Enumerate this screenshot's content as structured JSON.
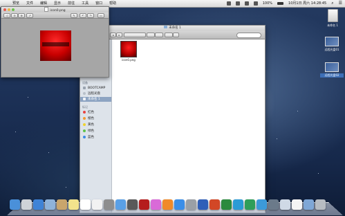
{
  "menubar": {
    "menus": [
      "预览",
      "文件",
      "编辑",
      "显示",
      "前往",
      "工具",
      "窗口",
      "帮助"
    ],
    "battery": "100%",
    "clock": "10月1日 周六 14:28:45"
  },
  "desktop": {
    "icons": [
      {
        "label": "未命名 1",
        "kind": "drive"
      },
      {
        "label": "远程光盘01",
        "kind": "screen"
      },
      {
        "label": "远程光盘02",
        "kind": "screen"
      }
    ]
  },
  "preview": {
    "title": "icon0.png",
    "toolbar": [
      "◁",
      "⊖",
      "⊕",
      "↗",
      "✎",
      "↶",
      "↷",
      "▭"
    ]
  },
  "finder": {
    "title": "未命名 1",
    "sidebar": {
      "top_items": [
        {
          "label": "下载"
        }
      ],
      "devices_header": "设备",
      "devices": [
        {
          "label": "BOOTCAMP"
        },
        {
          "label": "远程光盘"
        },
        {
          "label": "未命名 1",
          "selected": true
        }
      ],
      "tags_header": "标记",
      "tags": [
        {
          "label": "红色",
          "color": "#e84141"
        },
        {
          "label": "橙色",
          "color": "#f39b32"
        },
        {
          "label": "黄色",
          "color": "#efd32e"
        },
        {
          "label": "绿色",
          "color": "#5fc24a"
        },
        {
          "label": "蓝色",
          "color": "#3c8ce6"
        }
      ]
    },
    "file": {
      "name": "icon0.png"
    }
  },
  "dock": {
    "apps": [
      {
        "name": "finder-icon",
        "color": "#4a90d9"
      },
      {
        "name": "launchpad-icon",
        "color": "#cfd3d8"
      },
      {
        "name": "safari-icon",
        "color": "#3f83d6"
      },
      {
        "name": "mail-icon",
        "color": "#8fb3da"
      },
      {
        "name": "contacts-icon",
        "color": "#c9a56c"
      },
      {
        "name": "notes-icon",
        "color": "#f2e38c"
      },
      {
        "name": "calendar-icon",
        "color": "#ffffff"
      },
      {
        "name": "reminders-icon",
        "color": "#f2f2f2"
      },
      {
        "name": "photo-booth-icon",
        "color": "#8e8e8e"
      },
      {
        "name": "messages-icon",
        "color": "#5aa0e6"
      },
      {
        "name": "facetime-icon",
        "color": "#595959"
      },
      {
        "name": "photobooth-red-icon",
        "color": "#b51d1d"
      },
      {
        "name": "itunes-icon",
        "color": "#d96ad8"
      },
      {
        "name": "ibooks-icon",
        "color": "#f08a2a"
      },
      {
        "name": "app-store-icon",
        "color": "#3a8ee8"
      },
      {
        "name": "system-prefs-icon",
        "color": "#9aa0a6"
      },
      {
        "name": "word-icon",
        "color": "#2f5fb8"
      },
      {
        "name": "powerpoint-icon",
        "color": "#d24726"
      },
      {
        "name": "excel-icon",
        "color": "#2b8a3e"
      },
      {
        "name": "outlook-icon",
        "color": "#2b9bd6"
      },
      {
        "name": "lync-icon",
        "color": "#2f9e5a"
      },
      {
        "name": "messenger-icon",
        "color": "#3c9ad9"
      },
      {
        "name": "utility-icon",
        "color": "#6b7a8a"
      },
      {
        "name": "preview-icon",
        "color": "#cfd9e6"
      },
      {
        "name": "document-icon",
        "color": "#f4f4f4"
      },
      {
        "name": "folder-icon",
        "color": "#7fa7d6"
      },
      {
        "name": "trash-icon",
        "color": "#b7bcc2"
      }
    ]
  }
}
